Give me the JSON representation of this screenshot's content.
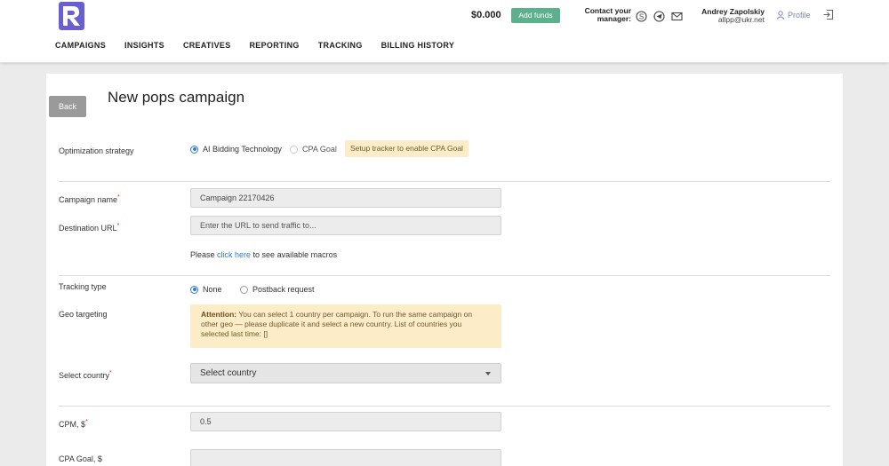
{
  "header": {
    "balance": "$0.000",
    "add_funds": "Add funds",
    "contact_line1": "Contact your",
    "contact_line2": "manager:",
    "user_name": "Andrey Zapolskiy",
    "user_email": "allpp@ukr.net",
    "profile": "Profile"
  },
  "nav": [
    "CAMPAIGNS",
    "INSIGHTS",
    "CREATIVES",
    "REPORTING",
    "TRACKING",
    "BILLING HISTORY"
  ],
  "page": {
    "back": "Back",
    "title": "New pops campaign"
  },
  "optimization": {
    "label": "Optimization strategy",
    "option_ai": "AI Bidding Technology",
    "option_cpa": "CPA Goal",
    "tracker_notice": "Setup tracker to enable CPA Goal"
  },
  "campaign_name": {
    "label": "Campaign name",
    "required": "*",
    "value": "Campaign 22170426"
  },
  "destination_url": {
    "label": "Destination URL",
    "required": "*",
    "placeholder": "Enter the URL to send traffic to...",
    "hint_before": "Please ",
    "hint_link": "click here",
    "hint_after": " to see available macros"
  },
  "tracking": {
    "label": "Tracking type",
    "option_none": "None",
    "option_postback": "Postback request"
  },
  "geo": {
    "label": "Geo targeting",
    "alert_title": "Attention:",
    "alert_text": " You can select 1 country per campaign. To run the same campaign on other geo — please duplicate it and select a new country. List of countries you selected last time: []"
  },
  "country": {
    "label": "Select country",
    "required": "*",
    "placeholder": "Select country"
  },
  "cpm": {
    "label": "CPM, $",
    "required": "*",
    "value": "0.5"
  },
  "cpa_goal": {
    "label": "CPA Goal, $"
  }
}
